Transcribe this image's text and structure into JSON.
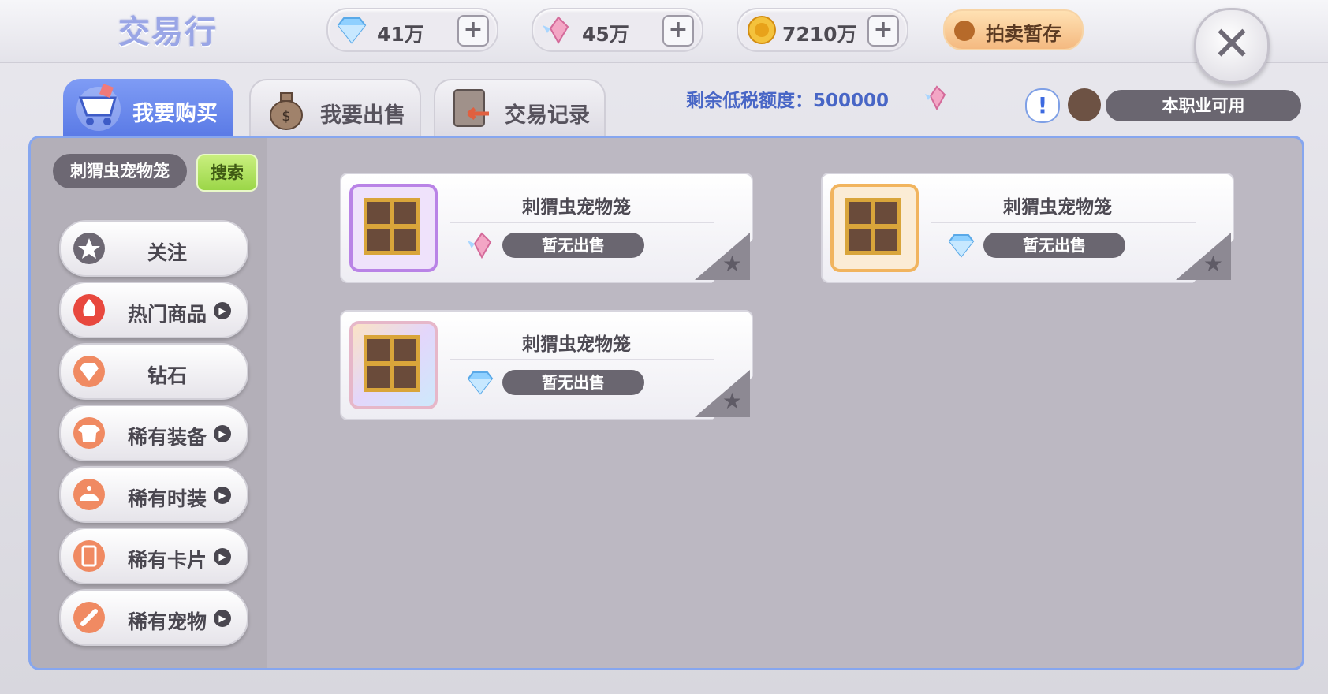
{
  "header": {
    "title": "交易行",
    "currencies": [
      {
        "icon": "diamond-icon",
        "value": "41万"
      },
      {
        "icon": "winged-gem-icon",
        "value": "45万"
      },
      {
        "icon": "zeny-coin-icon",
        "value": "7210万"
      }
    ],
    "auction_storage": "拍卖暂存"
  },
  "tabs": [
    {
      "label": "我要购买",
      "icon": "shopping-cart-icon",
      "active": true
    },
    {
      "label": "我要出售",
      "icon": "money-bag-icon",
      "active": false
    },
    {
      "label": "交易记录",
      "icon": "record-scroll-icon",
      "active": false
    }
  ],
  "tax": {
    "label": "剩余低税额度：",
    "value": "500000"
  },
  "job_filter": "本职业可用",
  "search": {
    "value": "刺猬虫宠物笼",
    "button": "搜索"
  },
  "categories": [
    {
      "label": "关注",
      "icon": "star-icon",
      "has_arrow": false
    },
    {
      "label": "热门商品",
      "icon": "hot-icon",
      "has_arrow": true
    },
    {
      "label": "钻石",
      "icon": "diamond-icon",
      "has_arrow": false
    },
    {
      "label": "稀有装备",
      "icon": "shirt-icon",
      "has_arrow": true
    },
    {
      "label": "稀有时装",
      "icon": "costume-icon",
      "has_arrow": true
    },
    {
      "label": "稀有卡片",
      "icon": "card-icon",
      "has_arrow": true
    },
    {
      "label": "稀有宠物",
      "icon": "bone-icon",
      "has_arrow": true
    }
  ],
  "items": [
    {
      "name": "刺猬虫宠物笼",
      "status": "暂无出售",
      "currency": "winged-gem-icon",
      "frame": "purple"
    },
    {
      "name": "刺猬虫宠物笼",
      "status": "暂无出售",
      "currency": "diamond-icon",
      "frame": "orange"
    },
    {
      "name": "刺猬虫宠物笼",
      "status": "暂无出售",
      "currency": "diamond-icon",
      "frame": "rainbow"
    }
  ],
  "colors": {
    "accent": "#5b7be6",
    "panel_border": "#86a6ef",
    "search_button": "#9bd648"
  }
}
